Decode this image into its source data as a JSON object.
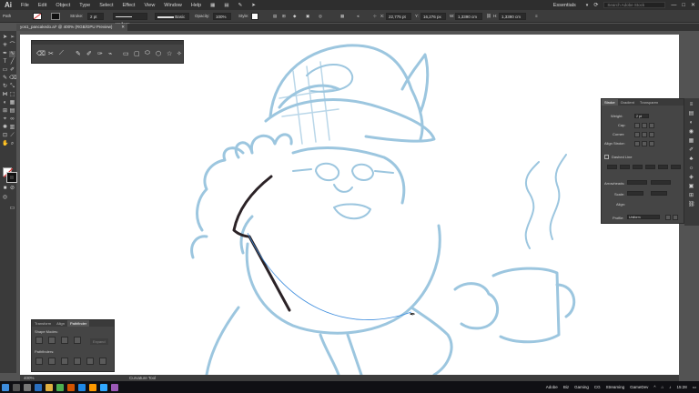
{
  "app": {
    "logo": "Ai"
  },
  "menu": [
    "File",
    "Edit",
    "Object",
    "Type",
    "Select",
    "Effect",
    "View",
    "Window",
    "Help"
  ],
  "workspace": {
    "name": "Essentials",
    "search_placeholder": "Search Adobe Stock"
  },
  "control_bar": {
    "selection_label": "Path",
    "stroke_label": "Stroke:",
    "stroke_weight": "2 pt",
    "profile": "Uniform",
    "brush": "Basic",
    "opacity_label": "Opacity:",
    "opacity_value": "100%",
    "style_label": "Style:",
    "x_value": "22,775 pt",
    "y_value": "16,276 px",
    "w_value": "1,3390 cm",
    "h_value": "1,3390 cm"
  },
  "document": {
    "tab_title": "yos1_pancakedo.ai* @ 400% (RGB/GPU Preview)"
  },
  "stroke_panel": {
    "tabs": [
      "Stroke",
      "Gradient",
      "Transparen"
    ],
    "weight_label": "Weight:",
    "weight_value": "2 pt",
    "cap_label": "Cap:",
    "corner_label": "Corner:",
    "align_label": "Align Stroke:",
    "dashed_label": "Dashed Line",
    "arrowheads_label": "Arrowheads:",
    "scale_label": "Scale:",
    "align2_label": "Align:",
    "profile_label": "Profile:",
    "profile_value": "Uniform"
  },
  "pathfinder_panel": {
    "tabs": [
      "Transform",
      "Align",
      "Pathfinder"
    ],
    "shape_modes_label": "Shape Modes:",
    "expand_label": "Expand",
    "pathfinders_label": "Pathfinders:"
  },
  "status": {
    "zoom": "400%",
    "tool": "Curvature Tool"
  },
  "taskbar": {
    "items": [
      "Adobe",
      "Biz",
      "Gaming",
      "CG",
      "Streaming",
      "GameDev"
    ],
    "clock": "15:28"
  },
  "colors": {
    "sketch": "#9cc6df",
    "ink": "#2b2226",
    "accent": "#3e8ddd"
  }
}
